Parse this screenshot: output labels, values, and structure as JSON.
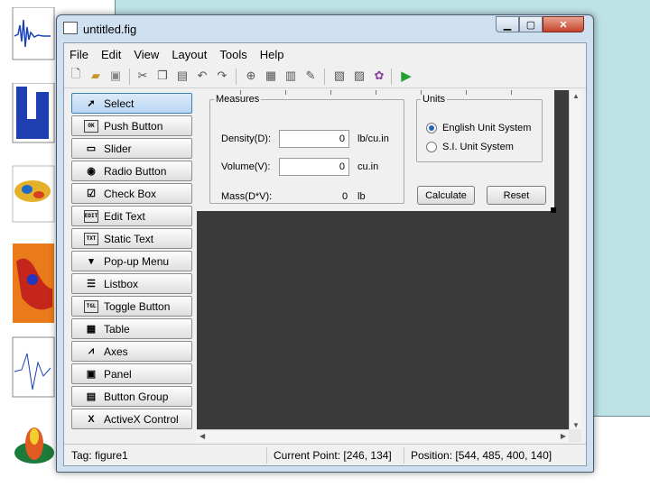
{
  "window": {
    "title": "untitled.fig"
  },
  "menu": [
    "File",
    "Edit",
    "View",
    "Layout",
    "Tools",
    "Help"
  ],
  "palette": [
    {
      "label": "Select",
      "icon": "cursor-arrow-icon",
      "glyph": "➚",
      "selected": true
    },
    {
      "label": "Push Button",
      "icon": "push-button-icon",
      "glyph": "OK"
    },
    {
      "label": "Slider",
      "icon": "slider-icon",
      "glyph": "▭"
    },
    {
      "label": "Radio Button",
      "icon": "radio-button-icon",
      "glyph": "◉"
    },
    {
      "label": "Check Box",
      "icon": "check-box-icon",
      "glyph": "☑"
    },
    {
      "label": "Edit Text",
      "icon": "edit-text-icon",
      "glyph": "EDIT"
    },
    {
      "label": "Static Text",
      "icon": "static-text-icon",
      "glyph": "TXT"
    },
    {
      "label": "Pop-up Menu",
      "icon": "popup-menu-icon",
      "glyph": "▾"
    },
    {
      "label": "Listbox",
      "icon": "listbox-icon",
      "glyph": "☰"
    },
    {
      "label": "Toggle Button",
      "icon": "toggle-button-icon",
      "glyph": "TGL"
    },
    {
      "label": "Table",
      "icon": "table-icon",
      "glyph": "▦"
    },
    {
      "label": "Axes",
      "icon": "axes-icon",
      "glyph": "⩘"
    },
    {
      "label": "Panel",
      "icon": "panel-icon",
      "glyph": "▣"
    },
    {
      "label": "Button Group",
      "icon": "button-group-icon",
      "glyph": "▤"
    },
    {
      "label": "ActiveX Control",
      "icon": "activex-icon",
      "glyph": "X"
    }
  ],
  "figure": {
    "measures": {
      "title": "Measures",
      "density_label": "Density(D):",
      "density_value": "0",
      "density_unit": "lb/cu.in",
      "volume_label": "Volume(V):",
      "volume_value": "0",
      "volume_unit": "cu.in",
      "mass_label": "Mass(D*V):",
      "mass_value": "0",
      "mass_unit": "lb"
    },
    "units": {
      "title": "Units",
      "option_english": "English Unit System",
      "option_si": "S.I. Unit System",
      "selected": "English Unit System"
    },
    "calculate_label": "Calculate",
    "reset_label": "Reset"
  },
  "status": {
    "tag": "Tag: figure1",
    "current_point": "Current Point:  [246, 134]",
    "position": "Position: [544, 485, 400, 140]"
  }
}
